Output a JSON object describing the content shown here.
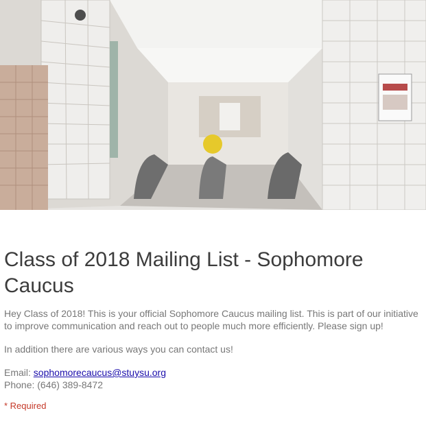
{
  "header": {
    "image_alt": "Hallway with moving walkways"
  },
  "form": {
    "title": "Class of 2018 Mailing List - Sophomore Caucus",
    "description_1": "Hey Class of 2018! This is your official Sophomore Caucus mailing list. This is part of our initiative to improve communication and reach out to people much more efficiently. Please sign up!",
    "description_2": "In addition there are various ways you can contact us!",
    "email_label": "Email: ",
    "email_value": "sophomorecaucus@stuysu.org",
    "phone_text": "Phone: (646) 389-8472",
    "required_note": "* Required"
  },
  "colors": {
    "title": "#3c3c3c",
    "body_text": "#777777",
    "link": "#1a0dab",
    "required": "#c53929"
  }
}
